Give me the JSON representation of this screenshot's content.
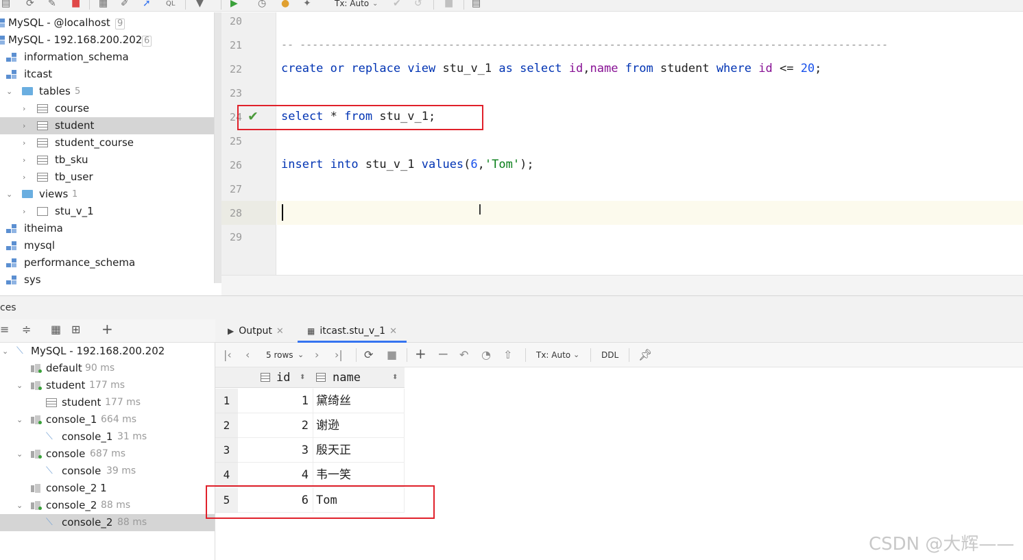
{
  "toolbar": {
    "tx_mode": "Tx: Auto",
    "icons": [
      "properties-icon",
      "refresh-icon",
      "edit-schema-icon",
      "stop-icon",
      "table-icon",
      "edit-icon",
      "jump-icon",
      "sql-icon",
      "filter-icon",
      "run-icon",
      "history-icon",
      "profile-icon",
      "settings-icon",
      "commit-icon",
      "rollback-icon",
      "stop-icon",
      "grid-icon"
    ]
  },
  "db_tree": {
    "items": [
      {
        "label": "MySQL - @localhost",
        "count": "9",
        "type": "connection"
      },
      {
        "label": "MySQL - 192.168.200.202",
        "count": "6",
        "type": "connection"
      },
      {
        "label": "information_schema",
        "type": "schema"
      },
      {
        "label": "itcast",
        "type": "schema"
      },
      {
        "label": "tables",
        "count": "5",
        "type": "folder"
      },
      {
        "label": "course",
        "type": "table"
      },
      {
        "label": "student",
        "type": "table"
      },
      {
        "label": "student_course",
        "type": "table"
      },
      {
        "label": "tb_sku",
        "type": "table"
      },
      {
        "label": "tb_user",
        "type": "table"
      },
      {
        "label": "views",
        "count": "1",
        "type": "folder"
      },
      {
        "label": "stu_v_1",
        "type": "view"
      },
      {
        "label": "itheima",
        "type": "schema"
      },
      {
        "label": "mysql",
        "type": "schema"
      },
      {
        "label": "performance_schema",
        "type": "schema"
      },
      {
        "label": "sys",
        "type": "schema"
      }
    ]
  },
  "editor": {
    "line_numbers": [
      "20",
      "21",
      "22",
      "23",
      "24",
      "25",
      "26",
      "27",
      "28",
      "29"
    ],
    "lines": {
      "l21": "-- -----------------------------------------------------------------------------------------------",
      "l22": {
        "t1": "create",
        "t2": " ",
        "t3": "or",
        "t4": " ",
        "t5": "replace",
        "t6": " ",
        "t7": "view",
        "t8": " stu_v_1 ",
        "t9": "as",
        "t10": " ",
        "t11": "select",
        "t12": " ",
        "t13": "id",
        "t14": ",",
        "t15": "name",
        "t16": " ",
        "t17": "from",
        "t18": " student ",
        "t19": "where",
        "t20": " ",
        "t21": "id",
        "t22": " <= ",
        "t23": "20",
        "t24": ";"
      },
      "l24": {
        "t1": "select",
        "t2": " * ",
        "t3": "from",
        "t4": " stu_v_1;"
      },
      "l26": {
        "t1": "insert",
        "t2": " ",
        "t3": "into",
        "t4": " stu_v_1 ",
        "t5": "values",
        "t6": "(",
        "t7": "6",
        "t8": ",",
        "t9": "'Tom'",
        "t10": ");"
      }
    }
  },
  "services": {
    "title": "ces",
    "tree": [
      {
        "label": "MySQL - 192.168.200.202",
        "ms": ""
      },
      {
        "label": "default",
        "ms": "90 ms"
      },
      {
        "label": "student",
        "ms": "177 ms"
      },
      {
        "label": "student",
        "ms": "177 ms"
      },
      {
        "label": "console_1",
        "ms": "664 ms"
      },
      {
        "label": "console_1",
        "ms": "31 ms"
      },
      {
        "label": "console",
        "ms": "687 ms"
      },
      {
        "label": "console",
        "ms": "39 ms"
      },
      {
        "label": "console_2 1",
        "ms": ""
      },
      {
        "label": "console_2",
        "ms": "88 ms"
      },
      {
        "label": "console_2",
        "ms": "88 ms"
      }
    ]
  },
  "result": {
    "tabs": [
      {
        "label": "Output"
      },
      {
        "label": "itcast.stu_v_1"
      }
    ],
    "rows_label": "5 rows",
    "tx_mode": "Tx: Auto",
    "ddl": "DDL",
    "columns": [
      "id",
      "name"
    ],
    "rows": [
      {
        "n": "1",
        "id": "1",
        "name": "黛绮丝"
      },
      {
        "n": "2",
        "id": "2",
        "name": "谢逊"
      },
      {
        "n": "3",
        "id": "3",
        "name": "殷天正"
      },
      {
        "n": "4",
        "id": "4",
        "name": "韦一笑"
      },
      {
        "n": "5",
        "id": "6",
        "name": "Tom"
      }
    ]
  },
  "watermark": "CSDN @大辉——",
  "colors": {
    "keyword": "#0033b3",
    "field": "#871094",
    "number": "#1750eb",
    "string": "#067d17",
    "highlight_box": "#e0202a",
    "check": "#4c9a3c"
  }
}
